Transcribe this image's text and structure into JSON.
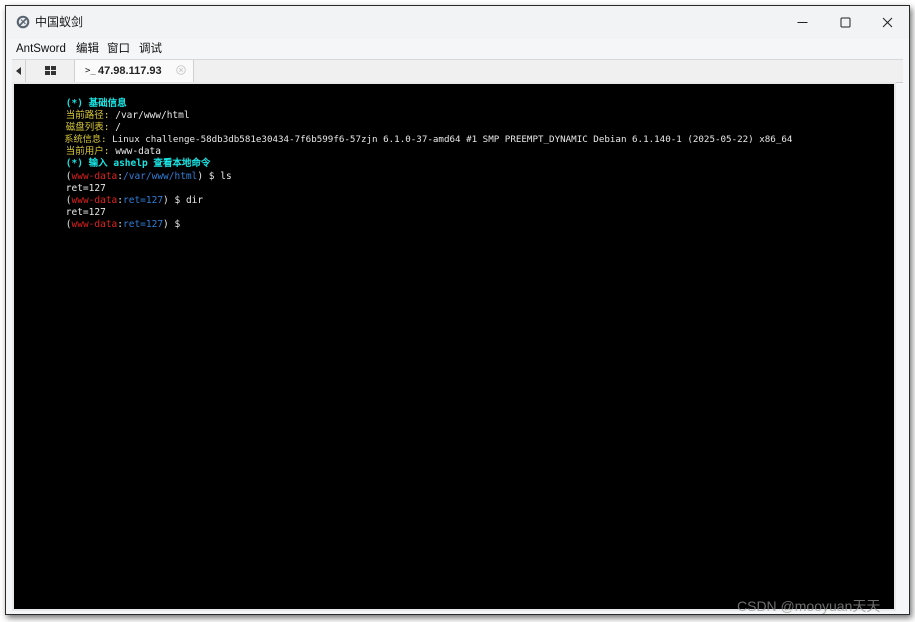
{
  "window": {
    "title": "中国蚁剑",
    "controls": {
      "minimize": "—",
      "maximize": "☐",
      "close": "✕"
    }
  },
  "menubar": {
    "items": [
      "AntSword",
      "编辑",
      "窗口",
      "调试"
    ]
  },
  "tabs": {
    "shell_tab": {
      "prompt_symbol": ">_",
      "label": "47.98.117.93"
    }
  },
  "terminal": {
    "basic_info_header": "(*) 基础信息",
    "current_path_label": "当前路径:",
    "current_path_value": " /var/www/html",
    "disk_list_label": "磁盘列表:",
    "disk_list_value": " /",
    "system_info_label": "系统信息:",
    "system_info_value": " Linux challenge-58db3db581e30434-7f6b599f6-57zjn 6.1.0-37-amd64 #1 SMP PREEMPT_DYNAMIC Debian 6.1.140-1 (2025-05-22) x86_64",
    "current_user_label": "当前用户:",
    "current_user_value": " www-data",
    "help_hint": "(*) 输入 ashelp 查看本地命令",
    "prompts": [
      {
        "open": "(",
        "user": "www-data",
        "sep": ":",
        "location": "/var/www/html",
        "close": ") $ ",
        "command": "ls",
        "output": "ret=127"
      },
      {
        "open": "(",
        "user": "www-data",
        "sep": ":",
        "location": "ret=127",
        "close": ") $ ",
        "command": "dir",
        "output": "ret=127"
      },
      {
        "open": "(",
        "user": "www-data",
        "sep": ":",
        "location": "ret=127",
        "close": ") $ ",
        "command": "",
        "output": ""
      }
    ]
  },
  "watermark": "CSDN @mooyuan天天",
  "colors": {
    "terminal_bg": "#000000",
    "header_cyan": "#19e3e3",
    "label_yellow": "#d8c83a",
    "prompt_user_red": "#e02020",
    "prompt_path_blue": "#2f7fd8",
    "text_white": "#e8e8e8"
  }
}
